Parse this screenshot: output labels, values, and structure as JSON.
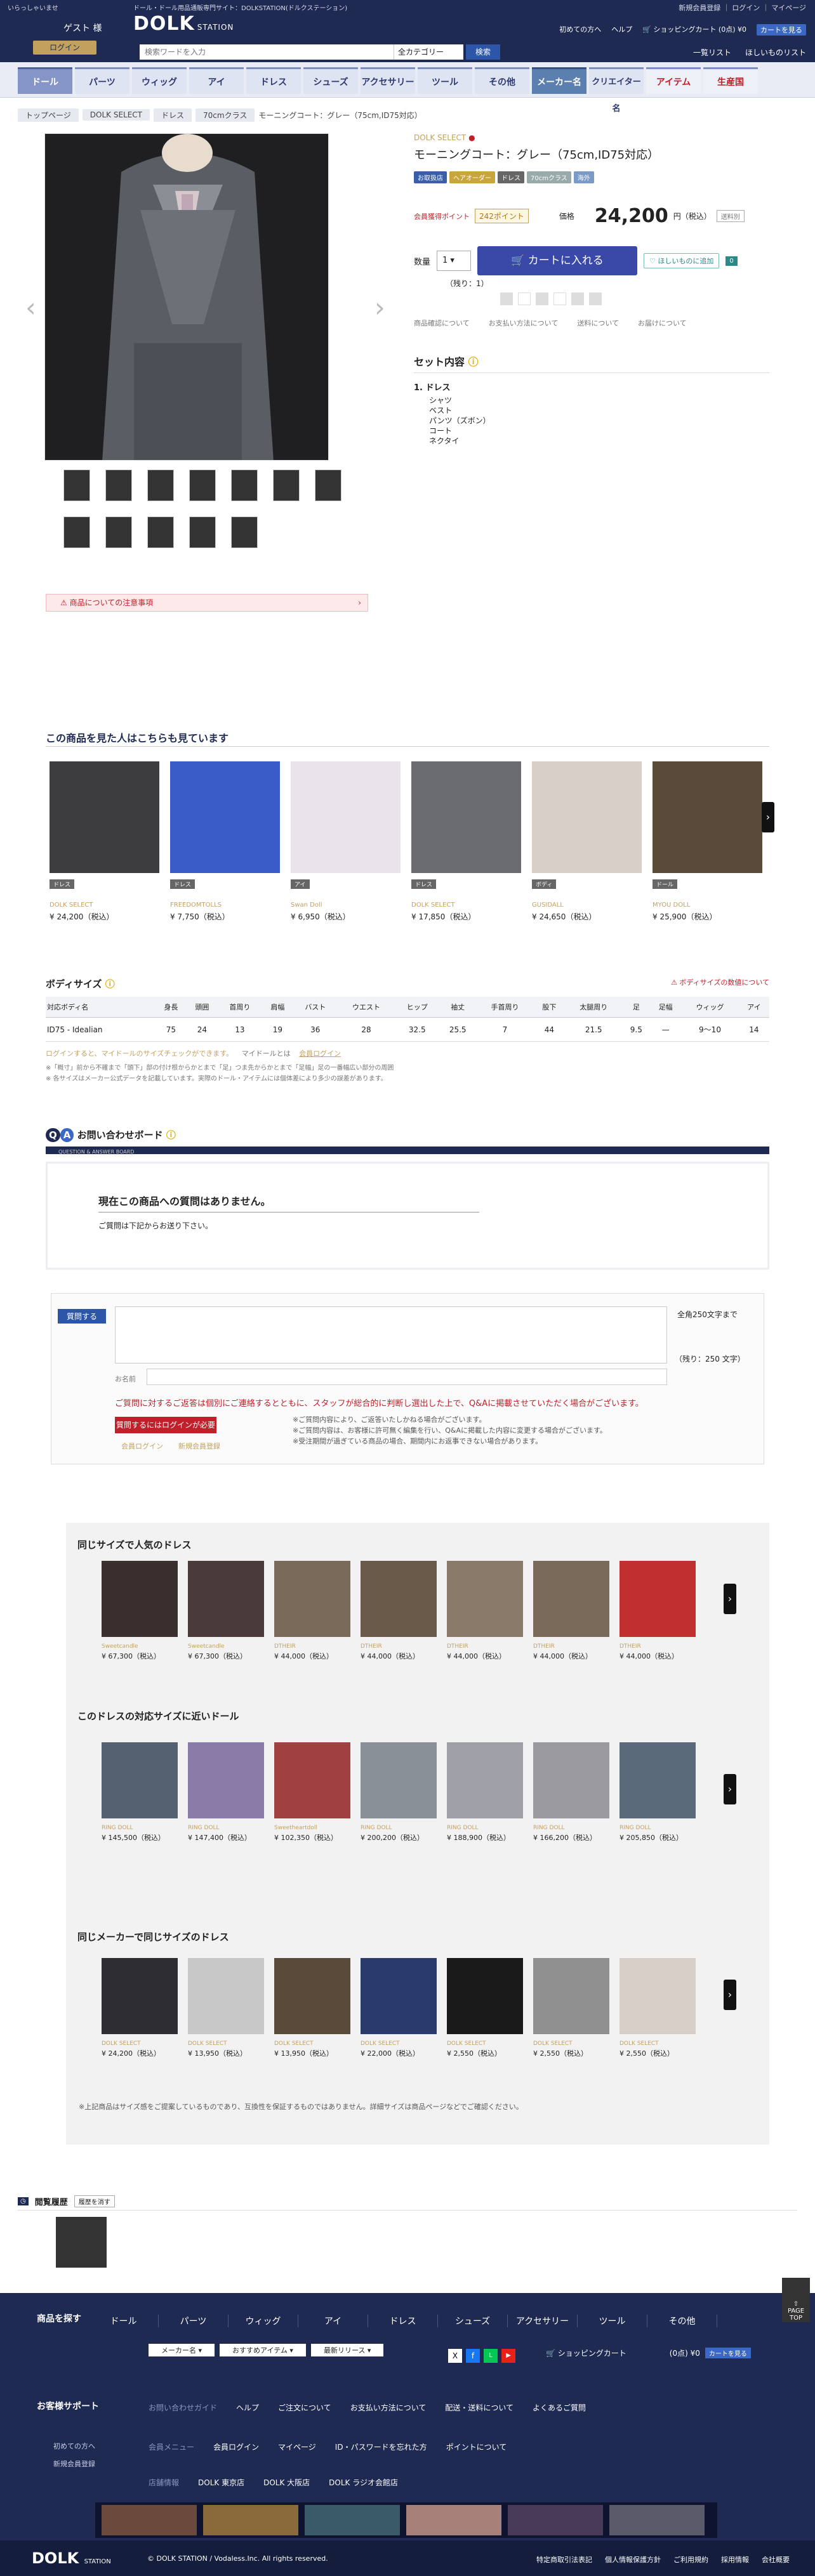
{
  "header": {
    "hello": "いらっしゃいませ",
    "guest": "ゲスト 様",
    "login": "ログイン",
    "tagline": "ドール・ドール用品通販専門サイト：DOLKSTATION(ドルクステーション)",
    "logo_main": "DOLK",
    "logo_sub": "STATION",
    "search_placeholder": "検索ワードを入力",
    "category": "全カテゴリー",
    "search_btn": "検索",
    "links_top": "新規会員登録 ｜ ログイン ｜ マイページ",
    "first_time": "初めての方へ",
    "help": "ヘルプ",
    "cart": "ショッピングカート",
    "cart_amount": "(0点) ¥0",
    "cart_button": "カートを見る",
    "list": "一覧リスト",
    "wishlist": "ほしいものリスト"
  },
  "nav": [
    "ドール",
    "パーツ",
    "ウィッグ",
    "アイ",
    "ドレス",
    "シューズ",
    "アクセサリー",
    "ツール",
    "その他",
    "メーカー名",
    "クリエイター名",
    "アイテム",
    "生産国"
  ],
  "breadcrumb": [
    "トップページ",
    "DOLK SELECT",
    "ドレス",
    "70cmクラス",
    "モーニングコート：グレー（75cm,ID75対応）"
  ],
  "product": {
    "maker": "DOLK SELECT",
    "title": "モーニングコート：グレー（75cm,ID75対応）",
    "badges": [
      {
        "t": "お取扱店",
        "c": "#3a5fa8"
      },
      {
        "t": "ヘアオーダー",
        "c": "#c9a63c"
      },
      {
        "t": "ドレス",
        "c": "#666"
      },
      {
        "t": "70cmクラス",
        "c": "#9aa"
      },
      {
        "t": "海外",
        "c": "#7a9ac8"
      }
    ],
    "point_label": "会員獲得ポイント",
    "points": "242ポイント",
    "price_label": "価格",
    "price": "24,200",
    "price_unit": "円（税込）",
    "tax_note": "送料別",
    "qty_label": "数量",
    "qty": "1",
    "stock": "（残り：1）",
    "cart": "カートに入れる",
    "fav": "ほしいものに追加",
    "fav_count": "0",
    "links": [
      "商品確認について",
      "お支払い方法について",
      "送料について",
      "お届けについて"
    ],
    "set_title": "セット内容",
    "set_category": "1. ドレス",
    "set_items": [
      "シャツ",
      "ベスト",
      "パンツ（ズボン）",
      "コート",
      "ネクタイ"
    ],
    "notice": "商品についての注意事項"
  },
  "also_viewed": {
    "title": "この商品を見た人はこちらも見ています",
    "items": [
      {
        "tag": "ドレス",
        "mk": "DOLK SELECT",
        "pr": "¥ 24,200（税込）"
      },
      {
        "tag": "ドレス",
        "mk": "FREEDOMTOLLS",
        "pr": "¥ 7,750（税込）"
      },
      {
        "tag": "アイ",
        "mk": "Swan Doll",
        "pr": "¥ 6,950（税込）"
      },
      {
        "tag": "ドレス",
        "mk": "DOLK SELECT",
        "pr": "¥ 17,850（税込）"
      },
      {
        "tag": "ボディ",
        "mk": "GUSIDALL",
        "pr": "¥ 24,650（税込）"
      },
      {
        "tag": "ドール",
        "mk": "MYOU DOLL",
        "pr": "¥ 25,900（税込）"
      }
    ]
  },
  "body_size": {
    "title": "ボディサイズ",
    "notice": "ボディサイズの数値について",
    "headers": [
      "対応ボディ名",
      "身長",
      "頭囲",
      "首周り",
      "肩幅",
      "バスト",
      "ウエスト",
      "ヒップ",
      "袖丈",
      "手首周り",
      "股下",
      "太腿周り",
      "足",
      "足幅",
      "ウィッグ",
      "アイ"
    ],
    "row": [
      "ID75 - Idealian",
      "75",
      "24",
      "13",
      "19",
      "36",
      "28",
      "32.5",
      "25.5",
      "7",
      "44",
      "21.5",
      "9.5",
      "—",
      "9〜10",
      "14"
    ],
    "note1": "ログインすると、マイドールのサイズチェックができます。",
    "note2": "マイドールとは",
    "note3": "会員ログイン",
    "note4": "※「概寸」前から不確まで「頭下」部の付け根からかとまで「足」つま先からかとまで「足幅」足の一番幅広い部分の周囲",
    "note5": "※ 各サイズはメーカー公式データを記載しています。実際のドール・アイテムには個体差により多少の誤差があります。"
  },
  "qa": {
    "title": "お問い合わせボード",
    "sub": "QUESTION & ANSWER BOARD",
    "empty": "現在この商品への質問はありません。",
    "prompt": "ご質問は下記からお送り下さい。",
    "ask": "質問する",
    "limit": "全角250文字まで",
    "remain": "（残り：250 文字）",
    "nickname": "お名前",
    "warn": "ご質問に対するご返答は個別にご連絡するとともに、スタッフが総合的に判断し選出した上で、Q&Aに掲載させていただく場合がございます。",
    "login_required": "質問するにはログインが必要です。",
    "login": "会員ログイン",
    "register": "新規会員登録",
    "note1": "※ご質問内容により、ご返答いたしかねる場合がございます。",
    "note2": "※ご質問内容は、お客様に許可無く編集を行い、Q&Aに掲載した内容に変更する場合がございます。",
    "note3": "※受注期間が過ぎている商品の場合、期間内にお返事できない場合があります。"
  },
  "popular": {
    "title": "同じサイズで人気のドレス",
    "items": [
      [
        "Sweetcandle",
        "¥ 67,300（税込）"
      ],
      [
        "Sweetcandle",
        "¥ 67,300（税込）"
      ],
      [
        "DTHEIR",
        "¥ 44,000（税込）"
      ],
      [
        "DTHEIR",
        "¥ 44,000（税込）"
      ],
      [
        "DTHEIR",
        "¥ 44,000（税込）"
      ],
      [
        "DTHEIR",
        "¥ 44,000（税込）"
      ],
      [
        "DTHEIR",
        "¥ 44,000（税込）"
      ]
    ]
  },
  "near_dolls": {
    "title": "このドレスの対応サイズに近いドール",
    "items": [
      [
        "RING DOLL",
        "¥ 145,500（税込）"
      ],
      [
        "RING DOLL",
        "¥ 147,400（税込）"
      ],
      [
        "Sweetheartdoll",
        "¥ 102,350（税込）"
      ],
      [
        "RING DOLL",
        "¥ 200,200（税込）"
      ],
      [
        "RING DOLL",
        "¥ 188,900（税込）"
      ],
      [
        "RING DOLL",
        "¥ 166,200（税込）"
      ],
      [
        "RING DOLL",
        "¥ 205,850（税込）"
      ]
    ]
  },
  "same_maker": {
    "title": "同じメーカーで同じサイズのドレス",
    "items": [
      [
        "DOLK SELECT",
        "¥ 24,200（税込）"
      ],
      [
        "DOLK SELECT",
        "¥ 13,950（税込）"
      ],
      [
        "DOLK SELECT",
        "¥ 13,950（税込）"
      ],
      [
        "DOLK SELECT",
        "¥ 22,000（税込）"
      ],
      [
        "DOLK SELECT",
        "¥ 2,550（税込）"
      ],
      [
        "DOLK SELECT",
        "¥ 2,550（税込）"
      ],
      [
        "DOLK SELECT",
        "¥ 2,550（税込）"
      ]
    ]
  },
  "size_note": "※上記商品はサイズ感をご提案しているものであり、互換性を保証するものではありません。詳細サイズは商品ページなどでご確認ください。",
  "history": {
    "title": "閲覧履歴",
    "clear": "履歴を消す"
  },
  "footer": {
    "search_title": "商品を探す",
    "nav": [
      "ドール",
      "パーツ",
      "ウィッグ",
      "アイ",
      "ドレス",
      "シューズ",
      "アクセサリー",
      "ツール",
      "その他"
    ],
    "support": "お客様サポート",
    "support_links1": [
      "お問い合わせガイド",
      "ヘルプ",
      "ご注文について",
      "お支払い方法について",
      "配送・送料について",
      "よくあるご質問"
    ],
    "support_links2": [
      "会員メニュー",
      "会員ログイン",
      "マイページ",
      "ID・パスワードを忘れた方",
      "ポイントについて"
    ],
    "support_links3": [
      "店舗情報",
      "DOLK 東京店",
      "DOLK 大阪店",
      "DOLK ラジオ会館店"
    ],
    "first": "初めての方へ",
    "register": "新規会員登録",
    "cart": "ショッピングカート",
    "cart_amount": "(0点) ¥0",
    "cart_btn": "カートを見る",
    "copyright": "© DOLK STATION / Vodaless.Inc. All rights reserved.",
    "legal": [
      "特定商取引法表記",
      "個人情報保護方針",
      "ご利用規約",
      "採用情報",
      "会社概要"
    ],
    "pagetop": "PAGE TOP"
  }
}
